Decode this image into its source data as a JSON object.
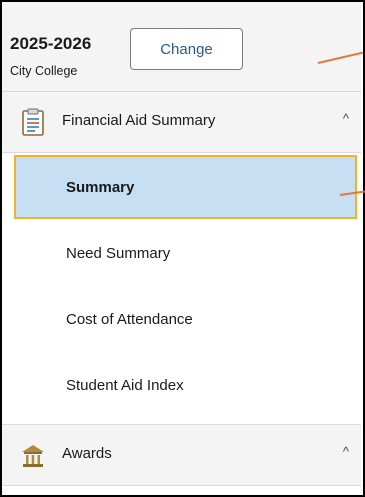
{
  "header": {
    "aid_year": "2025-2026",
    "college": "City College",
    "change_label": "Change"
  },
  "sections": [
    {
      "label": "Financial Aid Summary",
      "icon": "clipboard-icon",
      "chevron": "^",
      "items": [
        {
          "label": "Summary",
          "selected": true
        },
        {
          "label": "Need Summary",
          "selected": false
        },
        {
          "label": "Cost of Attendance",
          "selected": false
        },
        {
          "label": "Student Aid Index",
          "selected": false
        }
      ]
    },
    {
      "label": "Awards",
      "icon": "institution-icon",
      "chevron": "^",
      "items": []
    }
  ],
  "colors": {
    "selected_bg": "#c6dff3",
    "selected_border": "#f2b32a",
    "annotation_arrow": "#e07a38",
    "header_bg": "#f4f4f4"
  }
}
